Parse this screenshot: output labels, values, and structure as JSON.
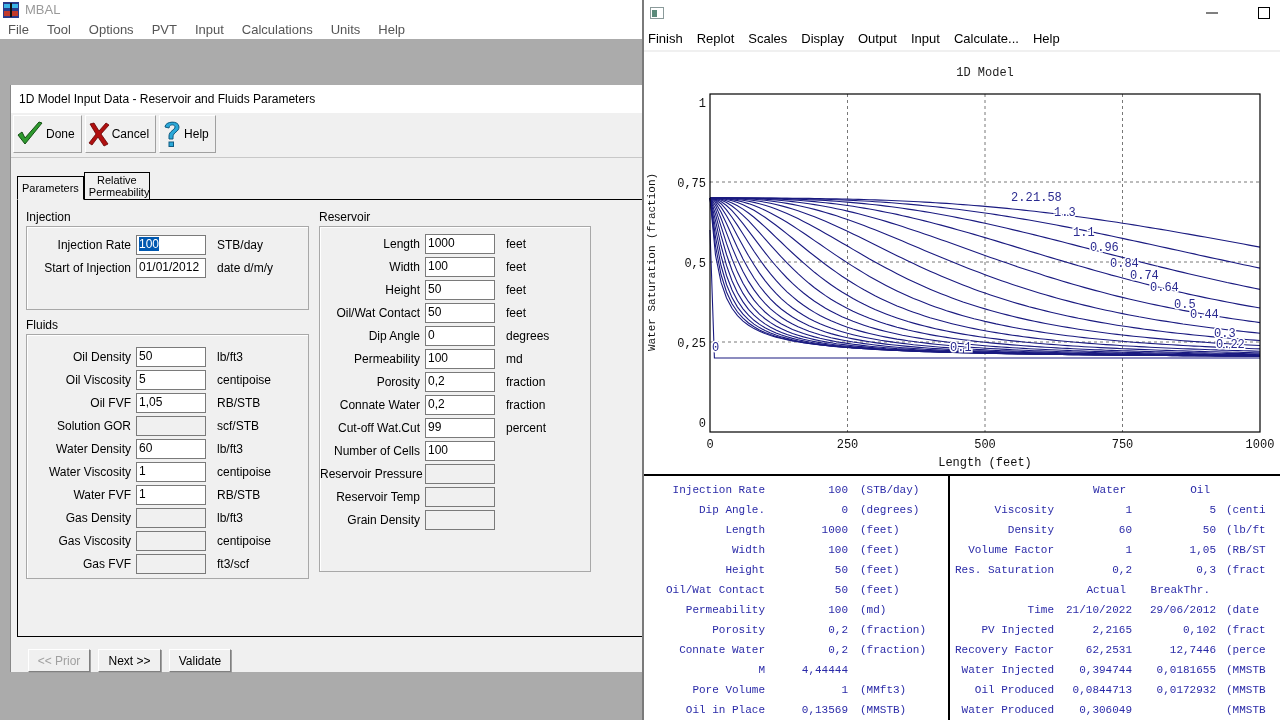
{
  "main_window": {
    "title": "MBAL",
    "menu": [
      "File",
      "Tool",
      "Options",
      "PVT",
      "Input",
      "Calculations",
      "Units",
      "Help"
    ]
  },
  "dialog": {
    "title": "1D Model Input Data - Reservoir and Fluids Parameters",
    "toolbar": [
      "Done",
      "Cancel",
      "Help"
    ],
    "tabs": [
      {
        "label": "Parameters",
        "selected": true
      },
      {
        "label": "Relative Permeability",
        "selected": false
      }
    ],
    "injection": {
      "title": "Injection",
      "fields": [
        {
          "label": "Injection Rate",
          "value": "100",
          "unit": "STB/day",
          "disabled": false,
          "highlighted": true
        },
        {
          "label": "Start of Injection",
          "value": "01/01/2012",
          "unit": "date d/m/y",
          "disabled": false,
          "highlighted": false
        }
      ]
    },
    "fluids": {
      "title": "Fluids",
      "fields": [
        {
          "label": "Oil Density",
          "value": "50",
          "unit": "lb/ft3",
          "disabled": false
        },
        {
          "label": "Oil Viscosity",
          "value": "5",
          "unit": "centipoise",
          "disabled": false
        },
        {
          "label": "Oil FVF",
          "value": "1,05",
          "unit": "RB/STB",
          "disabled": false
        },
        {
          "label": "Solution GOR",
          "unit": "scf/STB",
          "disabled": true
        },
        {
          "label": "Water Density",
          "value": "60",
          "unit": "lb/ft3",
          "disabled": false
        },
        {
          "label": "Water Viscosity",
          "value": "1",
          "unit": "centipoise",
          "disabled": false
        },
        {
          "label": "Water FVF",
          "value": "1",
          "unit": "RB/STB",
          "disabled": false
        },
        {
          "label": "Gas Density",
          "unit": "lb/ft3",
          "disabled": true
        },
        {
          "label": "Gas Viscosity",
          "unit": "centipoise",
          "disabled": true
        },
        {
          "label": "Gas FVF",
          "unit": "ft3/scf",
          "disabled": true
        }
      ]
    },
    "reservoir": {
      "title": "Reservoir",
      "fields": [
        {
          "label": "Length",
          "value": "1000",
          "unit": "feet",
          "disabled": false
        },
        {
          "label": "Width",
          "value": "100",
          "unit": "feet",
          "disabled": false
        },
        {
          "label": "Height",
          "value": "50",
          "unit": "feet",
          "disabled": false
        },
        {
          "label": "Oil/Wat Contact",
          "value": "50",
          "unit": "feet",
          "disabled": false
        },
        {
          "label": "Dip Angle",
          "value": "0",
          "unit": "degrees",
          "disabled": false
        },
        {
          "label": "Permeability",
          "value": "100",
          "unit": "md",
          "disabled": false
        },
        {
          "label": "Porosity",
          "value": "0,2",
          "unit": "fraction",
          "disabled": false
        },
        {
          "label": "Connate Water",
          "value": "0,2",
          "unit": "fraction",
          "disabled": false
        },
        {
          "label": "Cut-off Wat.Cut",
          "value": "99",
          "unit": "percent",
          "disabled": false
        },
        {
          "label": "Number of Cells",
          "value": "100",
          "disabled": false
        },
        {
          "label": "Reservoir Pressure",
          "disabled": true
        },
        {
          "label": "Reservoir Temp",
          "disabled": true
        },
        {
          "label": "Grain Density",
          "disabled": true
        }
      ]
    },
    "buttons": [
      {
        "label": "<< Prior",
        "disabled": true
      },
      {
        "label": "Next >>",
        "disabled": false
      },
      {
        "label": "Validate",
        "disabled": false
      }
    ]
  },
  "plot_window": {
    "menu": [
      "Finish",
      "Replot",
      "Scales",
      "Display",
      "Output",
      "Input",
      "Calculate...",
      "Help"
    ],
    "plot": {
      "title": "1D Model",
      "xlabel": "Length (feet)",
      "ylabel": "Water Saturation (fraction)",
      "xticks": [
        "0",
        "250",
        "500",
        "750",
        "1000"
      ],
      "yticks": [
        "1",
        "0,75",
        "0,5",
        "0,25",
        "0"
      ],
      "curve_labels": [
        "0",
        "0.1",
        "2.2",
        "1.58",
        "1.3",
        "1.1",
        "0.96",
        "0.84",
        "0.74",
        "0.64",
        "0.5",
        "0.44",
        "0.3",
        "0.22"
      ]
    },
    "summary_left": [
      {
        "label": "Injection Rate",
        "value": "100",
        "unit": "(STB/day)"
      },
      {
        "label": "Dip Angle.",
        "value": "0",
        "unit": "(degrees)"
      },
      {
        "label": "Length",
        "value": "1000",
        "unit": "(feet)"
      },
      {
        "label": "Width",
        "value": "100",
        "unit": "(feet)"
      },
      {
        "label": "Height",
        "value": "50",
        "unit": "(feet)"
      },
      {
        "label": "Oil/Wat Contact",
        "value": "50",
        "unit": "(feet)"
      },
      {
        "label": "Permeability",
        "value": "100",
        "unit": "(md)"
      },
      {
        "label": "Porosity",
        "value": "0,2",
        "unit": "(fraction)"
      },
      {
        "label": "Connate Water",
        "value": "0,2",
        "unit": "(fraction)"
      },
      {
        "label": "M",
        "value": "4,44444"
      },
      {
        "label": "Pore Volume",
        "value": "1",
        "unit": "(MMft3)"
      },
      {
        "label": "Oil in Place",
        "value": "0,13569",
        "unit": "(MMSTB)"
      }
    ],
    "summary_right": [
      {
        "kind": "header",
        "col1": "Water",
        "col2": "Oil"
      },
      {
        "kind": "row",
        "label": "Viscosity",
        "col1": "1",
        "col2": "5",
        "unit": "(centi"
      },
      {
        "kind": "row",
        "label": "Density",
        "col1": "60",
        "col2": "50",
        "unit": "(lb/ft"
      },
      {
        "kind": "row",
        "label": "Volume Factor",
        "col1": "1",
        "col2": "1,05",
        "unit": "(RB/ST"
      },
      {
        "kind": "row",
        "label": "Res. Saturation",
        "col1": "0,2",
        "col2": "0,3",
        "unit": "(fract"
      },
      {
        "kind": "header",
        "col1": "Actual",
        "col2": "BreakThr."
      },
      {
        "kind": "row",
        "label": "Time",
        "col1": "21/10/2022",
        "col2": "29/06/2012",
        "unit": "(date"
      },
      {
        "kind": "row",
        "label": "PV Injected",
        "col1": "2,2165",
        "col2": "0,102",
        "unit": "(fract"
      },
      {
        "kind": "row",
        "label": "Recovery Factor",
        "col1": "62,2531",
        "col2": "12,7446",
        "unit": "(perce"
      },
      {
        "kind": "row",
        "label": "Water Injected",
        "col1": "0,394744",
        "col2": "0,0181655",
        "unit": "(MMSTB"
      },
      {
        "kind": "row",
        "label": "Oil Produced",
        "col1": "0,0844713",
        "col2": "0,0172932",
        "unit": "(MMSTB"
      },
      {
        "kind": "row",
        "label": "Water Produced",
        "col1": "0,306049",
        "unit": "(MMSTB"
      }
    ]
  }
}
